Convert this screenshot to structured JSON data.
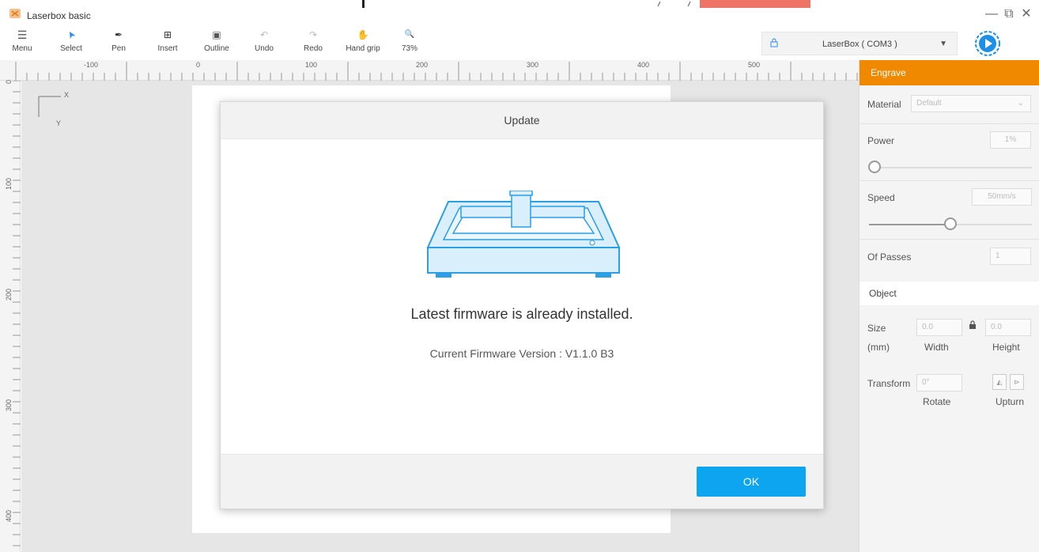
{
  "app": {
    "title": "Laserbox basic"
  },
  "window_controls": {
    "minimize": "—",
    "restore": "⧉",
    "close": "✕"
  },
  "toolbar": {
    "tools": [
      {
        "label": "Menu",
        "icon": "menu-icon",
        "glyph": "☰"
      },
      {
        "label": "Select",
        "icon": "cursor-icon",
        "glyph": "➤"
      },
      {
        "label": "Pen",
        "icon": "pen-icon",
        "glyph": "✒"
      },
      {
        "label": "Insert",
        "icon": "insert-icon",
        "glyph": "⊞"
      },
      {
        "label": "Outline",
        "icon": "outline-icon",
        "glyph": "▣"
      },
      {
        "label": "Undo",
        "icon": "undo-icon",
        "glyph": "↶"
      },
      {
        "label": "Redo",
        "icon": "redo-icon",
        "glyph": "↷"
      },
      {
        "label": "Hand grip",
        "icon": "hand-icon",
        "glyph": "✋"
      },
      {
        "label": "73%",
        "icon": "zoom-icon",
        "glyph": "🔍"
      }
    ]
  },
  "device": {
    "name": "LaserBox ( COM3 )",
    "caret": "▼",
    "lock_glyph": "🔒"
  },
  "ruler": {
    "top_labels": [
      "-100",
      "0",
      "100",
      "200",
      "300",
      "400",
      "500"
    ],
    "left_labels": [
      "0",
      "100",
      "200",
      "300",
      "400"
    ]
  },
  "canvas": {
    "axis_x": "X",
    "axis_y": "Y"
  },
  "panel": {
    "header": "Engrave",
    "material_label": "Material",
    "material_value": "Default",
    "power_label": "Power",
    "power_value": "1%",
    "speed_label": "Speed",
    "speed_value": "50mm/s",
    "passes_label": "Of Passes",
    "passes_value": "1",
    "object_header": "Object",
    "size_label": "Size",
    "size_unit": "(mm)",
    "width_value": "0.0",
    "height_value": "0.0",
    "width_label": "Width",
    "height_label": "Height",
    "transform_label": "Transform",
    "rotate_value": "0°",
    "rotate_label": "Rotate",
    "upturn_label": "Upturn",
    "power_level": 0.0,
    "speed_level": 0.5
  },
  "modal": {
    "title": "Update",
    "message": "Latest firmware is already installed.",
    "version": "Current Firmware Version : V1.1.0 B3",
    "ok": "OK"
  },
  "colors": {
    "accent_orange": "#f08900",
    "button_blue": "#0ea5f0",
    "machine_blue": "#2b9ee4",
    "top_strip_red": "#ed7467"
  }
}
